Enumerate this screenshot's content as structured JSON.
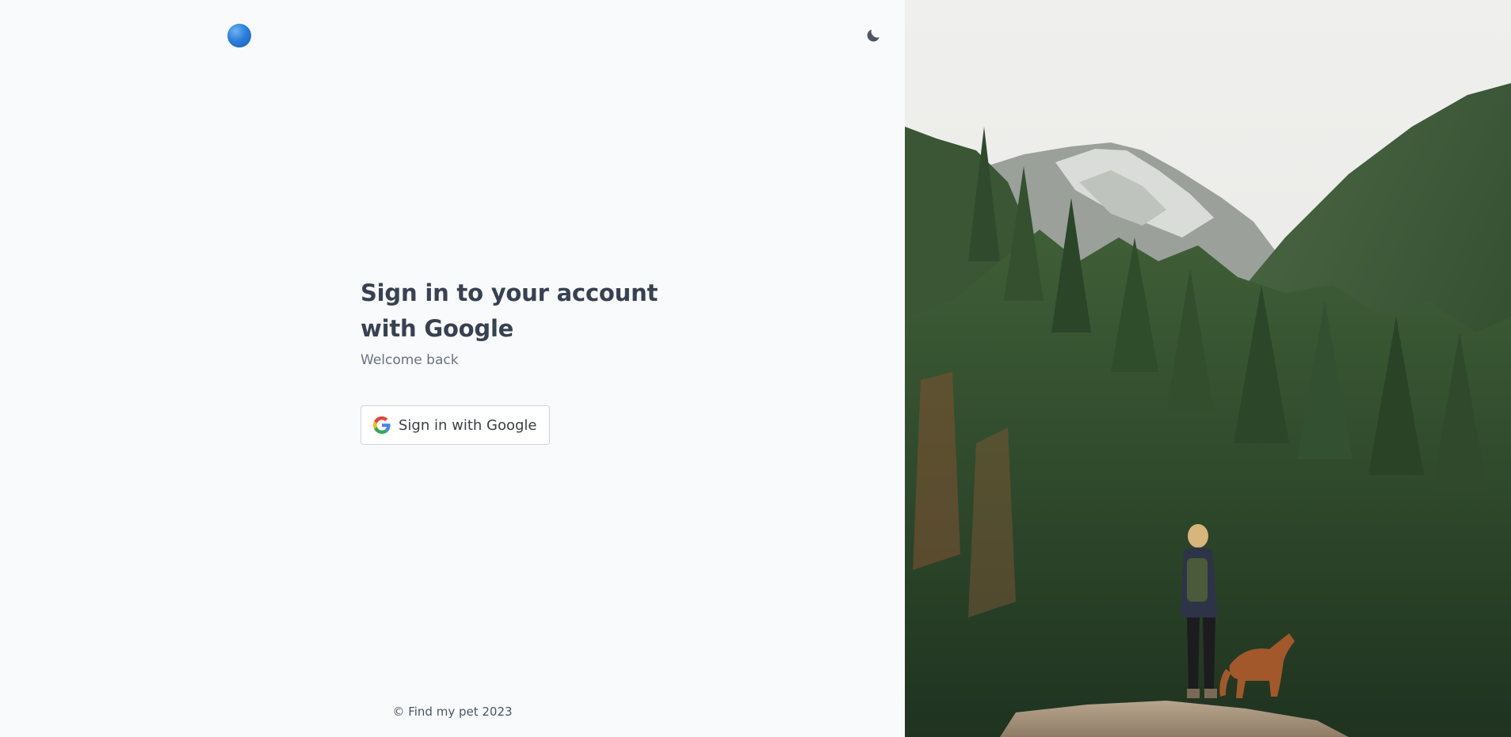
{
  "header": {
    "logo_icon": "blue-circle-logo",
    "theme_toggle_icon": "moon-icon"
  },
  "signin": {
    "title": "Sign in to your account with Google",
    "subtitle": "Welcome back",
    "google_button_label": "Sign in with Google",
    "google_icon": "google-g-icon"
  },
  "footer": {
    "copyright": "© Find my pet 2023"
  },
  "hero_image": {
    "icon": "landscape-photo"
  },
  "colors": {
    "background": "#f9fafb",
    "title": "#374151",
    "subtitle": "#6b7280",
    "button_border": "#d1d5db",
    "logo_blue": "#2a7fdc"
  }
}
